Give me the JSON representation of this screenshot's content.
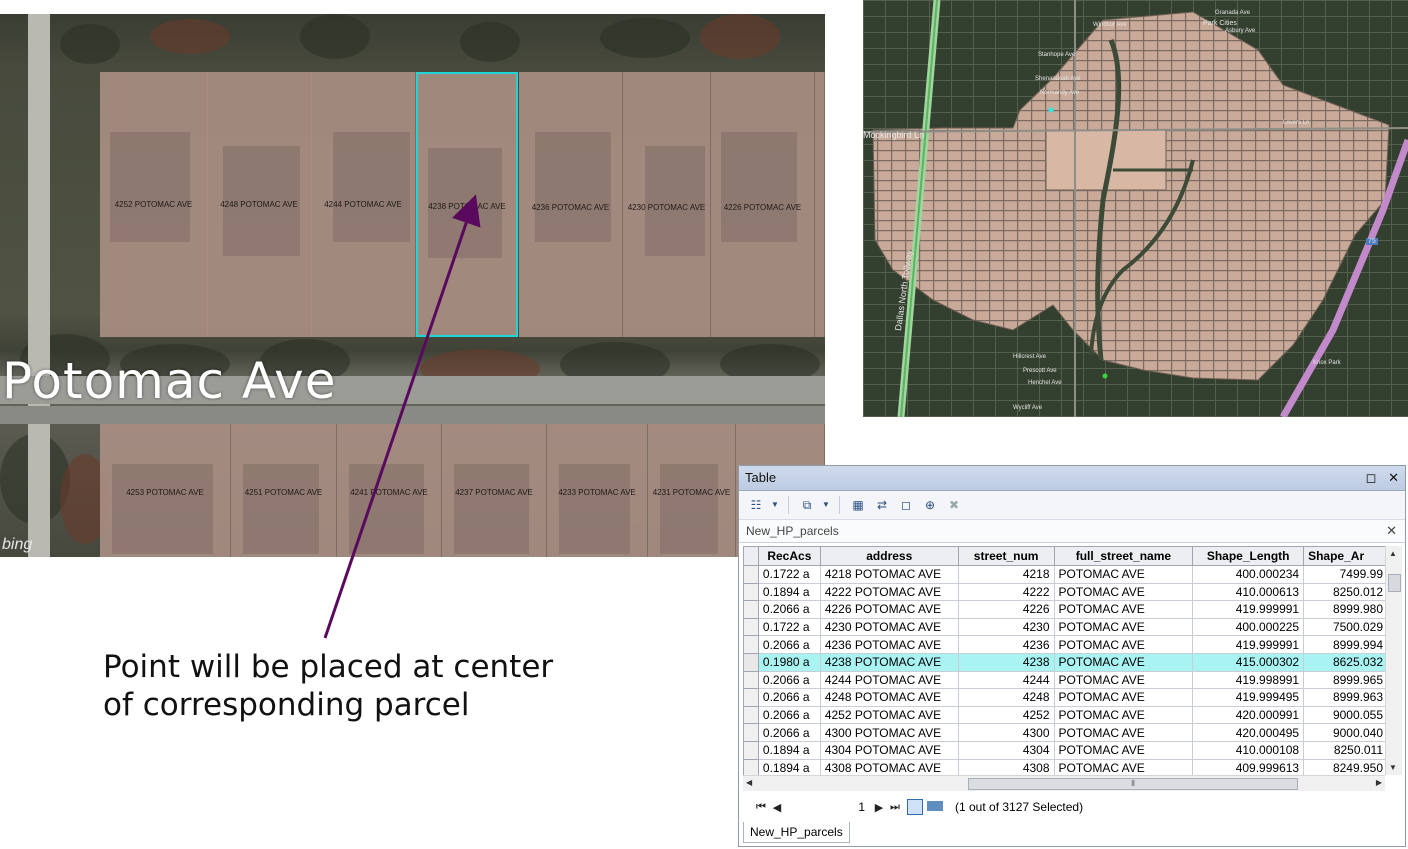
{
  "aerial": {
    "street_label": "Potomac Ave",
    "bing_logo": "bing",
    "north_parcels": [
      "4252 POTOMAC AVE",
      "4248 POTOMAC AVE",
      "4244 POTOMAC AVE",
      "4238 POTOMAC AVE",
      "4236 POTOMAC AVE",
      "4230 POTOMAC AVE",
      "4226 POTOMAC AVE"
    ],
    "south_parcels": [
      "4253 POTOMAC AVE",
      "4251 POTOMAC AVE",
      "4241 POTOMAC AVE",
      "4237 POTOMAC AVE",
      "4233 POTOMAC AVE",
      "4231 POTOMAC AVE"
    ],
    "selected_parcel": "4238 POTOMAC AVE",
    "selection_color": "#1fd6d6"
  },
  "overview": {
    "labels": [
      "Mockingbird Ln",
      "Dallas North Tollway",
      "75",
      "Hillcrest Ave",
      "Wycliff Ave",
      "Windsor Ave",
      "Stanhope Ave",
      "Shenandoah Ave",
      "Park Cities",
      "Granada Ave",
      "Asbury Ave",
      "Normandy Ave",
      "Lovers Ln",
      "Prescott Ave",
      "Henchel Ave",
      "Knox Park"
    ]
  },
  "caption": {
    "line1": "Point will be placed at center",
    "line2": "of corresponding parcel"
  },
  "arrow_color": "#5a0a5e",
  "table_window": {
    "title": "Table",
    "layer_tab": "New_HP_parcels",
    "bottom_tab": "New_HP_parcels",
    "columns": [
      "RecAcs",
      "address",
      "street_num",
      "full_street_name",
      "Shape_Length",
      "Shape_Ar"
    ],
    "rows": [
      {
        "recacs": "0.1722 a",
        "address": "4218 POTOMAC AVE",
        "street_num": "4218",
        "full_street_name": "POTOMAC AVE",
        "shape_length": "400.000234",
        "shape_area": "7499.99"
      },
      {
        "recacs": "0.1894 a",
        "address": "4222 POTOMAC AVE",
        "street_num": "4222",
        "full_street_name": "POTOMAC AVE",
        "shape_length": "410.000613",
        "shape_area": "8250.012"
      },
      {
        "recacs": "0.2066 a",
        "address": "4226 POTOMAC AVE",
        "street_num": "4226",
        "full_street_name": "POTOMAC AVE",
        "shape_length": "419.999991",
        "shape_area": "8999.980"
      },
      {
        "recacs": "0.1722 a",
        "address": "4230 POTOMAC AVE",
        "street_num": "4230",
        "full_street_name": "POTOMAC AVE",
        "shape_length": "400.000225",
        "shape_area": "7500.029"
      },
      {
        "recacs": "0.2066 a",
        "address": "4236 POTOMAC AVE",
        "street_num": "4236",
        "full_street_name": "POTOMAC AVE",
        "shape_length": "419.999991",
        "shape_area": "8999.994"
      },
      {
        "recacs": "0.1980 a",
        "address": "4238 POTOMAC AVE",
        "street_num": "4238",
        "full_street_name": "POTOMAC AVE",
        "shape_length": "415.000302",
        "shape_area": "8625.032",
        "highlighted": true
      },
      {
        "recacs": "0.2066 a",
        "address": "4244 POTOMAC AVE",
        "street_num": "4244",
        "full_street_name": "POTOMAC AVE",
        "shape_length": "419.998991",
        "shape_area": "8999.965"
      },
      {
        "recacs": "0.2066 a",
        "address": "4248 POTOMAC AVE",
        "street_num": "4248",
        "full_street_name": "POTOMAC AVE",
        "shape_length": "419.999495",
        "shape_area": "8999.963"
      },
      {
        "recacs": "0.2066 a",
        "address": "4252 POTOMAC AVE",
        "street_num": "4252",
        "full_street_name": "POTOMAC AVE",
        "shape_length": "420.000991",
        "shape_area": "9000.055"
      },
      {
        "recacs": "0.2066 a",
        "address": "4300 POTOMAC AVE",
        "street_num": "4300",
        "full_street_name": "POTOMAC AVE",
        "shape_length": "420.000495",
        "shape_area": "9000.040"
      },
      {
        "recacs": "0.1894 a",
        "address": "4304 POTOMAC AVE",
        "street_num": "4304",
        "full_street_name": "POTOMAC AVE",
        "shape_length": "410.000108",
        "shape_area": "8250.011"
      },
      {
        "recacs": "0.1894 a",
        "address": "4308 POTOMAC AVE",
        "street_num": "4308",
        "full_street_name": "POTOMAC AVE",
        "shape_length": "409.999613",
        "shape_area": "8249.950"
      }
    ],
    "page_number": "1",
    "selection_status": "(1 out of 3127 Selected)",
    "highlight_color": "#a9f3f3"
  }
}
